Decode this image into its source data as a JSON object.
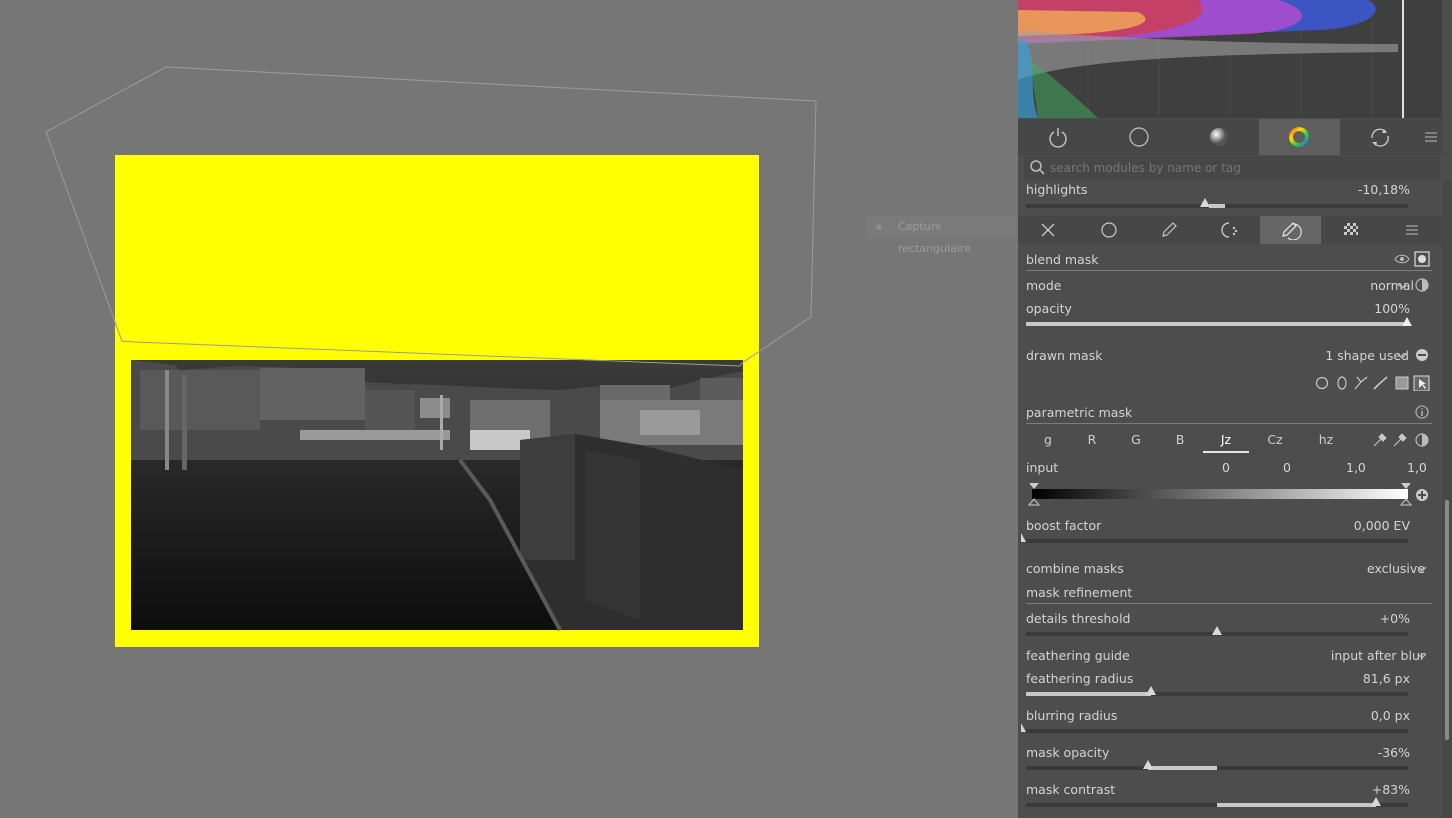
{
  "canvas": {
    "tooltip": "Capture rectangulaire"
  },
  "module_groups": {
    "tabs": [
      "active-modules",
      "base-modules",
      "tone-modules",
      "color-modules",
      "correct-modules"
    ],
    "active_tab": "color-modules",
    "menu_icon": "hamburger-icon"
  },
  "search": {
    "placeholder": "search modules by name or tag"
  },
  "highlights": {
    "label": "highlights",
    "value": "-10,18%",
    "level": -10.18
  },
  "mask_tabs": {
    "tabs": [
      "off",
      "uniformly",
      "drawn-mask",
      "parametric-mask",
      "drawn-and-parametric",
      "raster-mask"
    ],
    "active_tab": "drawn-and-parametric"
  },
  "blend_mask": {
    "label": "blend mask"
  },
  "mode": {
    "label": "mode",
    "value": "normal"
  },
  "opacity": {
    "label": "opacity",
    "value": "100%",
    "level": 100
  },
  "drawn_mask": {
    "label": "drawn mask",
    "value": "1 shape used",
    "shapes": [
      "circle-icon",
      "ellipse-icon",
      "path-icon",
      "brush-icon",
      "gradient-icon",
      "show-edit-icon"
    ]
  },
  "parametric_mask": {
    "label": "parametric mask",
    "channels": [
      "g",
      "R",
      "G",
      "B",
      "Jz",
      "Cz",
      "hz"
    ],
    "active_channel": "Jz"
  },
  "input": {
    "label": "input",
    "values": [
      "0",
      "0",
      "1,0",
      "1,0"
    ]
  },
  "boost_factor": {
    "label": "boost factor",
    "value": "0,000 EV"
  },
  "combine_masks": {
    "label": "combine masks",
    "value": "exclusive"
  },
  "mask_refinement": {
    "label": "mask refinement"
  },
  "details_threshold": {
    "label": "details threshold",
    "value": "+0%"
  },
  "feathering_guide": {
    "label": "feathering guide",
    "value": "input after blur"
  },
  "feathering_radius": {
    "label": "feathering radius",
    "value": "81,6 px",
    "level": 81.6,
    "max": 250
  },
  "blurring_radius": {
    "label": "blurring radius",
    "value": "0,0 px"
  },
  "mask_opacity": {
    "label": "mask opacity",
    "value": "-36%",
    "level": -36
  },
  "mask_contrast": {
    "label": "mask contrast",
    "value": "+83%",
    "level": 83
  },
  "colors": {
    "mask_overlay": "#ffff00",
    "panel": "#4d4d4d",
    "background": "#767676"
  }
}
